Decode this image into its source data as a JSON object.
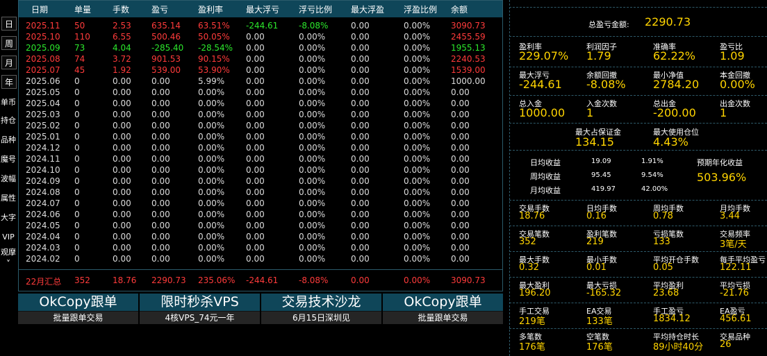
{
  "side_tabs": [
    "日",
    "周",
    "月",
    "年"
  ],
  "side_links": [
    "单币",
    "持仓",
    "品种",
    "魔号",
    "波幅",
    "属性",
    "大字",
    "VIP",
    "观摩"
  ],
  "side_scroll": "˅",
  "headers": [
    "日期",
    "单量",
    "手数",
    "盈亏",
    "盈利率",
    "最大浮亏",
    "浮亏比例",
    "最大浮盈",
    "浮盈比例",
    "余额"
  ],
  "rows": [
    {
      "date": "2025.11",
      "orders": "50",
      "lots": "2.53",
      "pnl": "635.14",
      "rate": "63.51%",
      "max_fl": "-244.61",
      "fl_ratio": "-8.08%",
      "max_fp": "0.00",
      "fp_ratio": "0.00%",
      "bal": "3090.73",
      "color": "red",
      "flc": "green"
    },
    {
      "date": "2025.10",
      "orders": "110",
      "lots": "6.55",
      "pnl": "500.46",
      "rate": "50.05%",
      "max_fl": "0.00",
      "fl_ratio": "0.00%",
      "max_fp": "0.00",
      "fp_ratio": "0.00%",
      "bal": "2455.59",
      "color": "red",
      "flc": "white"
    },
    {
      "date": "2025.09",
      "orders": "73",
      "lots": "4.04",
      "pnl": "-285.40",
      "rate": "-28.54%",
      "max_fl": "0.00",
      "fl_ratio": "0.00%",
      "max_fp": "0.00",
      "fp_ratio": "0.00%",
      "bal": "1955.13",
      "color": "green",
      "flc": "white"
    },
    {
      "date": "2025.08",
      "orders": "74",
      "lots": "3.72",
      "pnl": "901.53",
      "rate": "90.15%",
      "max_fl": "0.00",
      "fl_ratio": "0.00%",
      "max_fp": "0.00",
      "fp_ratio": "0.00%",
      "bal": "2240.53",
      "color": "red",
      "flc": "white"
    },
    {
      "date": "2025.07",
      "orders": "45",
      "lots": "1.92",
      "pnl": "539.00",
      "rate": "53.90%",
      "max_fl": "0.00",
      "fl_ratio": "0.00%",
      "max_fp": "0.00",
      "fp_ratio": "0.00%",
      "bal": "1539.00",
      "color": "red",
      "flc": "white"
    },
    {
      "date": "2025.06",
      "orders": "0",
      "lots": "0.00",
      "pnl": "0.00",
      "rate": "5.99%",
      "max_fl": "0.00",
      "fl_ratio": "0.00%",
      "max_fp": "0.00",
      "fp_ratio": "0.00%",
      "bal": "1000.00",
      "color": "white",
      "flc": "white"
    },
    {
      "date": "2025.05",
      "orders": "0",
      "lots": "0.00",
      "pnl": "0.00",
      "rate": "0.00%",
      "max_fl": "0.00",
      "fl_ratio": "0.00%",
      "max_fp": "0.00",
      "fp_ratio": "0.00%",
      "bal": "0.00",
      "color": "white",
      "flc": "white"
    },
    {
      "date": "2025.04",
      "orders": "0",
      "lots": "0.00",
      "pnl": "0.00",
      "rate": "0.00%",
      "max_fl": "0.00",
      "fl_ratio": "0.00%",
      "max_fp": "0.00",
      "fp_ratio": "0.00%",
      "bal": "0.00",
      "color": "white",
      "flc": "white"
    },
    {
      "date": "2025.03",
      "orders": "0",
      "lots": "0.00",
      "pnl": "0.00",
      "rate": "0.00%",
      "max_fl": "0.00",
      "fl_ratio": "0.00%",
      "max_fp": "0.00",
      "fp_ratio": "0.00%",
      "bal": "0.00",
      "color": "white",
      "flc": "white"
    },
    {
      "date": "2025.02",
      "orders": "0",
      "lots": "0.00",
      "pnl": "0.00",
      "rate": "0.00%",
      "max_fl": "0.00",
      "fl_ratio": "0.00%",
      "max_fp": "0.00",
      "fp_ratio": "0.00%",
      "bal": "0.00",
      "color": "white",
      "flc": "white"
    },
    {
      "date": "2025.01",
      "orders": "0",
      "lots": "0.00",
      "pnl": "0.00",
      "rate": "0.00%",
      "max_fl": "0.00",
      "fl_ratio": "0.00%",
      "max_fp": "0.00",
      "fp_ratio": "0.00%",
      "bal": "0.00",
      "color": "white",
      "flc": "white"
    },
    {
      "date": "2024.12",
      "orders": "0",
      "lots": "0.00",
      "pnl": "0.00",
      "rate": "0.00%",
      "max_fl": "0.00",
      "fl_ratio": "0.00%",
      "max_fp": "0.00",
      "fp_ratio": "0.00%",
      "bal": "0.00",
      "color": "white",
      "flc": "white"
    },
    {
      "date": "2024.11",
      "orders": "0",
      "lots": "0.00",
      "pnl": "0.00",
      "rate": "0.00%",
      "max_fl": "0.00",
      "fl_ratio": "0.00%",
      "max_fp": "0.00",
      "fp_ratio": "0.00%",
      "bal": "0.00",
      "color": "white",
      "flc": "white"
    },
    {
      "date": "2024.10",
      "orders": "0",
      "lots": "0.00",
      "pnl": "0.00",
      "rate": "0.00%",
      "max_fl": "0.00",
      "fl_ratio": "0.00%",
      "max_fp": "0.00",
      "fp_ratio": "0.00%",
      "bal": "0.00",
      "color": "white",
      "flc": "white"
    },
    {
      "date": "2024.09",
      "orders": "0",
      "lots": "0.00",
      "pnl": "0.00",
      "rate": "0.00%",
      "max_fl": "0.00",
      "fl_ratio": "0.00%",
      "max_fp": "0.00",
      "fp_ratio": "0.00%",
      "bal": "0.00",
      "color": "white",
      "flc": "white"
    },
    {
      "date": "2024.08",
      "orders": "0",
      "lots": "0.00",
      "pnl": "0.00",
      "rate": "0.00%",
      "max_fl": "0.00",
      "fl_ratio": "0.00%",
      "max_fp": "0.00",
      "fp_ratio": "0.00%",
      "bal": "0.00",
      "color": "white",
      "flc": "white"
    },
    {
      "date": "2024.07",
      "orders": "0",
      "lots": "0.00",
      "pnl": "0.00",
      "rate": "0.00%",
      "max_fl": "0.00",
      "fl_ratio": "0.00%",
      "max_fp": "0.00",
      "fp_ratio": "0.00%",
      "bal": "0.00",
      "color": "white",
      "flc": "white"
    },
    {
      "date": "2024.06",
      "orders": "0",
      "lots": "0.00",
      "pnl": "0.00",
      "rate": "0.00%",
      "max_fl": "0.00",
      "fl_ratio": "0.00%",
      "max_fp": "0.00",
      "fp_ratio": "0.00%",
      "bal": "0.00",
      "color": "white",
      "flc": "white"
    },
    {
      "date": "2024.05",
      "orders": "0",
      "lots": "0.00",
      "pnl": "0.00",
      "rate": "0.00%",
      "max_fl": "0.00",
      "fl_ratio": "0.00%",
      "max_fp": "0.00",
      "fp_ratio": "0.00%",
      "bal": "0.00",
      "color": "white",
      "flc": "white"
    },
    {
      "date": "2024.04",
      "orders": "0",
      "lots": "0.00",
      "pnl": "0.00",
      "rate": "0.00%",
      "max_fl": "0.00",
      "fl_ratio": "0.00%",
      "max_fp": "0.00",
      "fp_ratio": "0.00%",
      "bal": "0.00",
      "color": "white",
      "flc": "white"
    },
    {
      "date": "2024.03",
      "orders": "0",
      "lots": "0.00",
      "pnl": "0.00",
      "rate": "0.00%",
      "max_fl": "0.00",
      "fl_ratio": "0.00%",
      "max_fp": "0.00",
      "fp_ratio": "0.00%",
      "bal": "0.00",
      "color": "white",
      "flc": "white"
    },
    {
      "date": "2024.02",
      "orders": "0",
      "lots": "0.00",
      "pnl": "0.00",
      "rate": "0.00%",
      "max_fl": "0.00",
      "fl_ratio": "0.00%",
      "max_fp": "0.00",
      "fp_ratio": "0.00%",
      "bal": "0.00",
      "color": "white",
      "flc": "white"
    }
  ],
  "summary": {
    "date": "22月汇总",
    "orders": "352",
    "lots": "18.76",
    "pnl": "2290.73",
    "rate": "235.06%",
    "max_fl": "-244.61",
    "fl_ratio": "-8.08%",
    "max_fp": "0.00",
    "fp_ratio": "0.00%",
    "bal": "3090.73"
  },
  "ads": [
    {
      "title": "OkCopy跟单",
      "sub": "批量跟单交易"
    },
    {
      "title": "限时秒杀VPS",
      "sub": "4核VPS_74元一年"
    },
    {
      "title": "交易技术沙龙",
      "sub": "6月15日深圳见"
    },
    {
      "title": "OkCopy跟单",
      "sub": "批量跟单交易"
    }
  ],
  "stats": {
    "total_pnl_label": "总盈亏金额:",
    "total_pnl": "2290.73",
    "b1": [
      {
        "l": "盈利率",
        "v": "229.07%"
      },
      {
        "l": "利润因子",
        "v": "1.79"
      },
      {
        "l": "准确率",
        "v": "62.22%"
      },
      {
        "l": "盈亏比",
        "v": "1.09"
      },
      {
        "l": "最大浮亏",
        "v": "-244.61"
      },
      {
        "l": "余额回撤",
        "v": "-8.08%"
      },
      {
        "l": "最小净值",
        "v": "2784.20"
      },
      {
        "l": "本金回撤",
        "v": "0.00%"
      },
      {
        "l": "总入金",
        "v": "1000.00"
      },
      {
        "l": "入金次数",
        "v": "1"
      },
      {
        "l": "总出金",
        "v": "-200.00"
      },
      {
        "l": "出金次数",
        "v": "1"
      }
    ],
    "margin": [
      {
        "l": "最大占保证金",
        "v": "134.15"
      },
      {
        "l": "最大使用仓位",
        "v": "4.43%"
      }
    ],
    "avg": [
      {
        "l": "日均收益",
        "a": "19.09",
        "p": "1.91%"
      },
      {
        "l": "周均收益",
        "a": "95.45",
        "p": "9.54%"
      },
      {
        "l": "月均收益",
        "a": "419.97",
        "p": "42.00%"
      }
    ],
    "annual_label": "预期年化收益",
    "annual": "503.96%",
    "b2": [
      {
        "l": "交易手数",
        "v": "18.76"
      },
      {
        "l": "日均手数",
        "v": "0.16"
      },
      {
        "l": "周均手数",
        "v": "0.78"
      },
      {
        "l": "月均手数",
        "v": "3.44"
      },
      {
        "l": "交易笔数",
        "v": "352"
      },
      {
        "l": "盈利笔数",
        "v": "219"
      },
      {
        "l": "亏损笔数",
        "v": "133"
      },
      {
        "l": "交易频率",
        "v": "3笔/天"
      },
      {
        "l": "最大手数",
        "v": "0.32"
      },
      {
        "l": "最小手数",
        "v": "0.01"
      },
      {
        "l": "平均开仓手数",
        "v": "0.05"
      },
      {
        "l": "每手平均盈亏",
        "v": "122.11"
      },
      {
        "l": "最大盈利",
        "v": "196.20"
      },
      {
        "l": "最大亏损",
        "v": "-165.32"
      },
      {
        "l": "平均盈利",
        "v": "23.68"
      },
      {
        "l": "平均亏损",
        "v": "-21.76"
      },
      {
        "l": "手工交易",
        "v": "219笔"
      },
      {
        "l": "EA交易",
        "v": "133笔"
      },
      {
        "l": "手工盈亏",
        "v": "1834.12"
      },
      {
        "l": "EA盈亏",
        "v": "456.61"
      },
      {
        "l": "多笔数",
        "v": "176笔"
      },
      {
        "l": "空笔数",
        "v": "176笔"
      },
      {
        "l": "平均持仓时长",
        "v": "89小时40分"
      },
      {
        "l": "交易品种",
        "v": "26"
      }
    ]
  },
  "colors": {
    "header_bg": "#0f4659",
    "profit": "#ff3b3b",
    "loss": "#2ce82c",
    "stat_value": "#ffd400"
  }
}
